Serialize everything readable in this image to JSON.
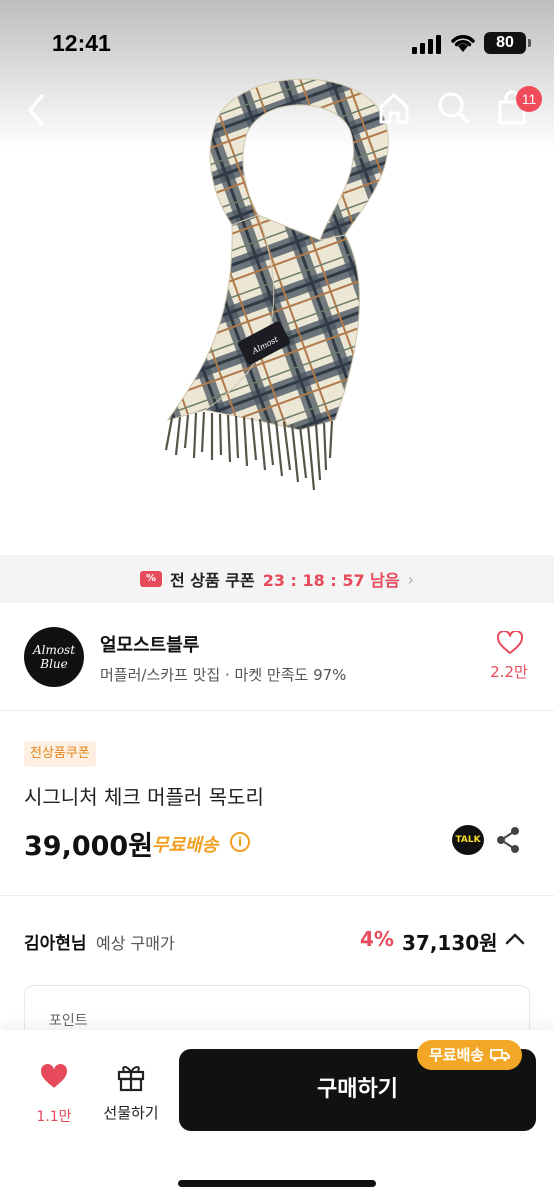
{
  "status_bar": {
    "time": "12:41",
    "battery": "80"
  },
  "nav": {
    "cart_badge": "11"
  },
  "coupon_banner": {
    "icon": "%",
    "text": "전 상품 쿠폰",
    "timer": "23 : 18 : 57 남음"
  },
  "seller": {
    "logo_text": "Almost Blue",
    "name": "얼모스트블루",
    "subtitle": "머플러/스카프 맛집 · 마켓 만족도 97%",
    "likes": "2.2만"
  },
  "product": {
    "badge": "전상품쿠폰",
    "title": "시그니처 체크 머플러 목도리",
    "price": "39,000원",
    "free_shipping": "무료배송",
    "talk_label": "TALK"
  },
  "expected_price": {
    "user_name": "김아현님",
    "label": "예상 구매가",
    "discount": "4%",
    "price": "37,130원"
  },
  "points": {
    "label": "포인트"
  },
  "bottom_bar": {
    "like_count": "1.1만",
    "gift_label": "선물하기",
    "buy_label": "구매하기",
    "ship_badge": "무료배송"
  },
  "colors": {
    "accent": "#e64a5b",
    "shipping": "#f3a726",
    "buy_button": "#111111"
  }
}
